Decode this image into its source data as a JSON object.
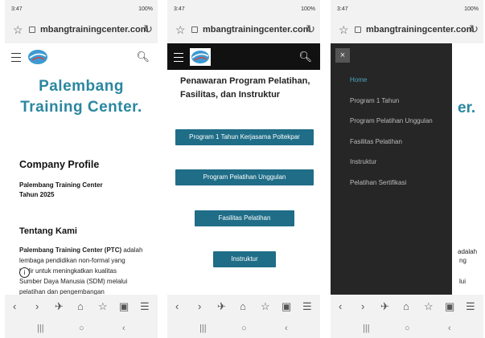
{
  "colors": {
    "accent": "#2a87a0",
    "button": "#1f6d87",
    "drawer_bg": "#262626",
    "active_link": "#4aa6c0"
  },
  "status": {
    "time": "3:47",
    "right": "100%"
  },
  "browser": {
    "url": "mbangtrainingcenter.com"
  },
  "icons": [
    "star-icon",
    "lock-icon",
    "reload-icon",
    "hamburger-icon",
    "search-icon",
    "back-icon",
    "forward-icon",
    "bolt-icon",
    "home-icon",
    "bookmark-icon",
    "tabs-icon",
    "menu-icon",
    "recents-icon",
    "home-button-icon",
    "back-nav-icon",
    "close-icon",
    "info-icon"
  ],
  "panel1": {
    "hero_line1": "Palembang",
    "hero_line2": "Training Center.",
    "company_profile": "Company Profile",
    "org_line1": "Palembang Training Center",
    "org_line2": "Tahun 2025",
    "about_heading": "Tentang Kami",
    "about_bold": "Palembang Training Center (PTC)",
    "about_rest": " adalah",
    "about_lines": [
      "lembaga pendidikan non-formal yang",
      "hadir untuk meningkatkan kualitas",
      "Sumber Daya Manusia (SDM) melalui",
      "pelatihan dan pengembangan"
    ]
  },
  "panel2": {
    "heading": "Penawaran Program Pelatihan, Fasilitas, dan Instruktur",
    "buttons": [
      "Program 1 Tahun Kerjasama Poltekpar",
      "Program Pelatihan Unggulan",
      "Fasilitas Pelatihan",
      "Instruktur"
    ]
  },
  "panel3": {
    "close": "×",
    "menu": [
      "Home",
      "Program 1 Tahun",
      "Program Pelatihan Unggulan",
      "Fasilitas Pelatihan",
      "Instruktur",
      "Pelatihan Sertifikasi"
    ],
    "peek": {
      "hero": "er.",
      "line1": "adalah",
      "line2": "ng",
      "line3": "lui"
    }
  }
}
